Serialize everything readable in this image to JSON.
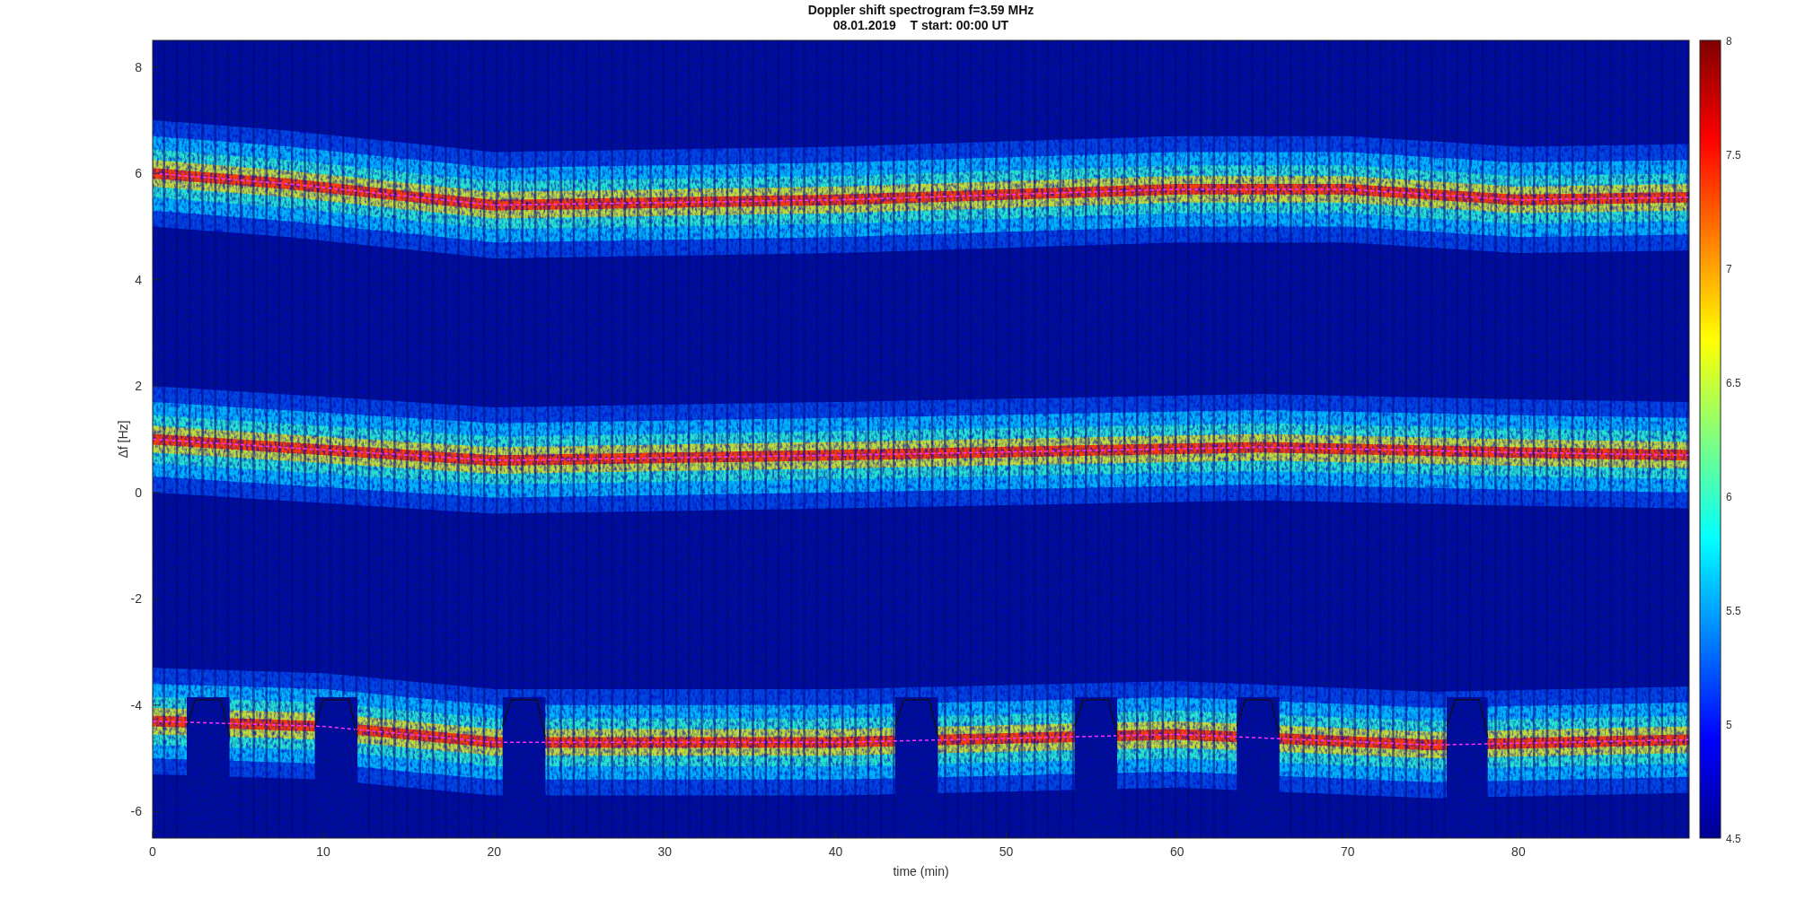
{
  "chart": {
    "title_lines": [
      "Doppler shift spectrogram f=3.59 MHz",
      "08.01.2019    T start: 00:00 UT"
    ],
    "ylabel": "Δf [Hz]",
    "xlabel": "time (min)",
    "yticks": [
      "8",
      "6",
      "4",
      "2",
      "0",
      "-2",
      "-4",
      "-6"
    ],
    "xticks": [
      "0",
      "10",
      "20",
      "30",
      "40",
      "50",
      "60",
      "70",
      "80"
    ],
    "colorbar_ticks": [
      "8",
      "7.5",
      "7",
      "6.5",
      "6",
      "5.5",
      "5",
      "4.5"
    ]
  }
}
